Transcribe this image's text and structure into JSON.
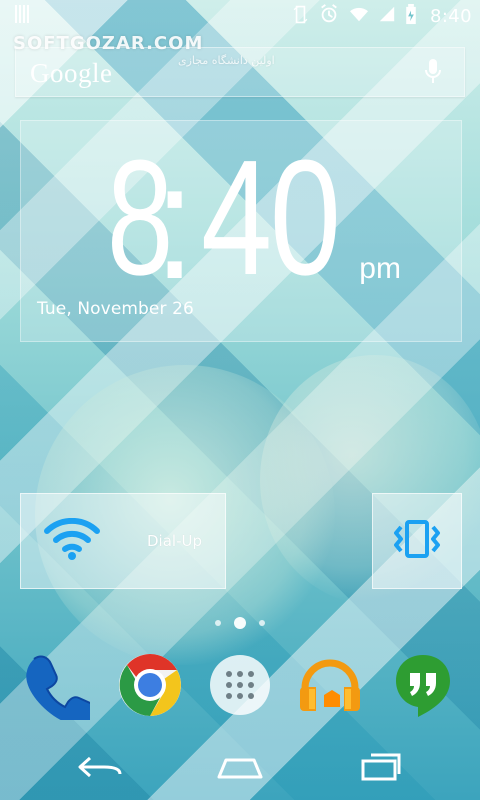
{
  "status_bar": {
    "time": "8:40",
    "icons": [
      "notification-icon",
      "rotate-icon",
      "alarm-icon",
      "wifi-icon",
      "signal-icon",
      "battery-icon"
    ]
  },
  "watermark": {
    "main": "SOFTGOZAR.COM",
    "sub": "اولین دانشگاه مجازی"
  },
  "search_widget": {
    "brand": "Google",
    "icon": "mic-icon"
  },
  "clock_widget": {
    "hour": "8",
    "minutes": "40",
    "ampm": "pm",
    "date": "Tue, November 26"
  },
  "quick_settings": {
    "wifi_label": "Dial-Up",
    "vibrate_icon": "vibrate-icon",
    "wifi_icon": "wifi-icon"
  },
  "dock": {
    "apps": [
      {
        "name": "phone",
        "icon": "phone-icon"
      },
      {
        "name": "chrome",
        "icon": "chrome-icon"
      },
      {
        "name": "apps",
        "icon": "app-drawer-icon"
      },
      {
        "name": "play-music",
        "icon": "headphones-icon"
      },
      {
        "name": "hangouts",
        "icon": "hangouts-icon"
      }
    ]
  },
  "navigation": {
    "icons": [
      "back-icon",
      "home-icon",
      "recent-apps-icon"
    ]
  },
  "colors": {
    "accent_blue": "#1ba1f2",
    "phone_blue": "#1565c0",
    "hangouts_green": "#2e9d32",
    "music_orange": "#f39a11"
  }
}
